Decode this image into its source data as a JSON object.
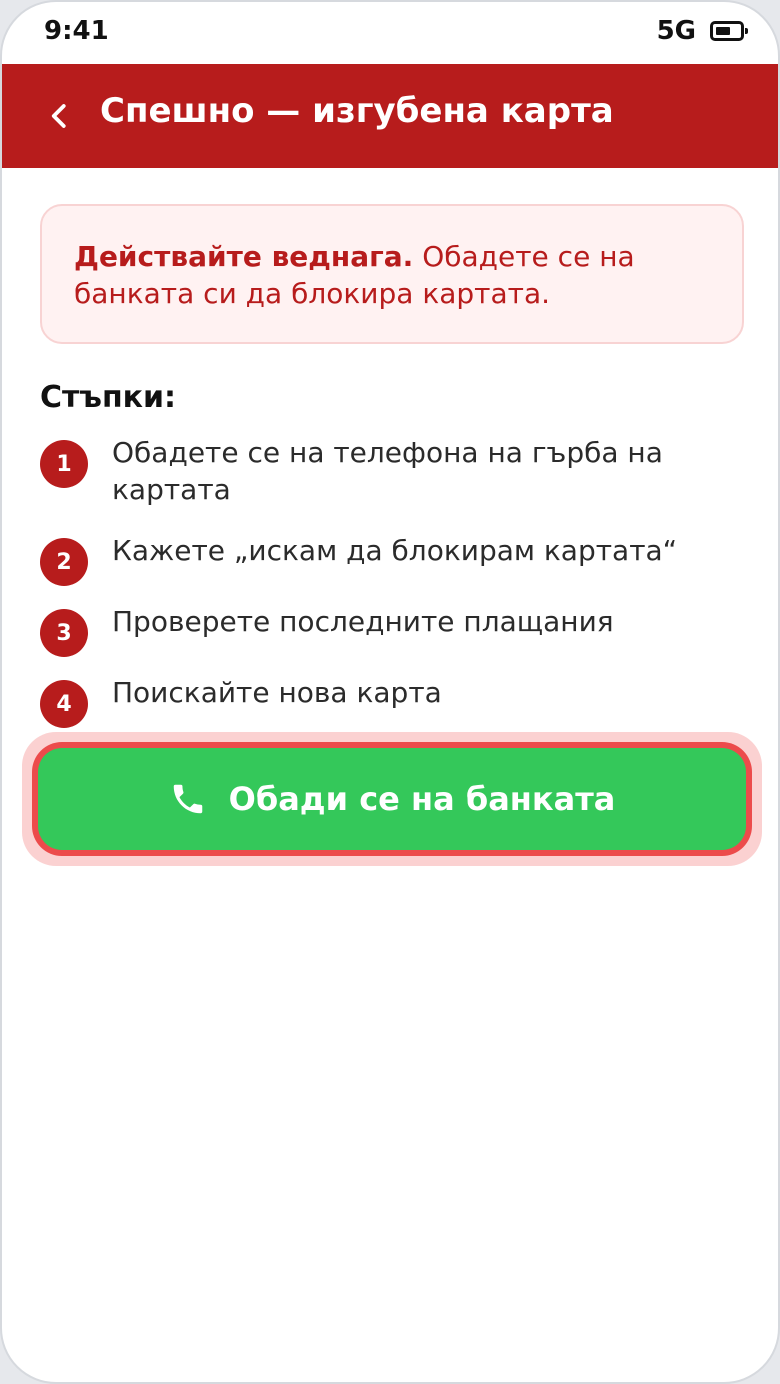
{
  "status": {
    "time": "9:41",
    "network": "5G"
  },
  "header": {
    "title": "Спешно — изгубена карта",
    "back_icon": "chevron-left-icon"
  },
  "alert": {
    "bold": "Действайте веднага.",
    "text": " Обадете се на банката си да блокира картата."
  },
  "steps": {
    "heading": "Стъпки:",
    "items": [
      {
        "number": "1",
        "text": "Обадете се на телефона на гърба на картата"
      },
      {
        "number": "2",
        "text": "Кажете „искам да блокирам картата“"
      },
      {
        "number": "3",
        "text": "Проверете последните плащания"
      },
      {
        "number": "4",
        "text": "Поискайте нова карта"
      }
    ]
  },
  "call_button": {
    "label": "Обади се на банката",
    "icon": "phone-icon"
  },
  "colors": {
    "header_red": "#b71c1c",
    "alert_bg": "#fff2f2",
    "button_green": "#34c85a",
    "button_border": "#ec4b4b"
  }
}
